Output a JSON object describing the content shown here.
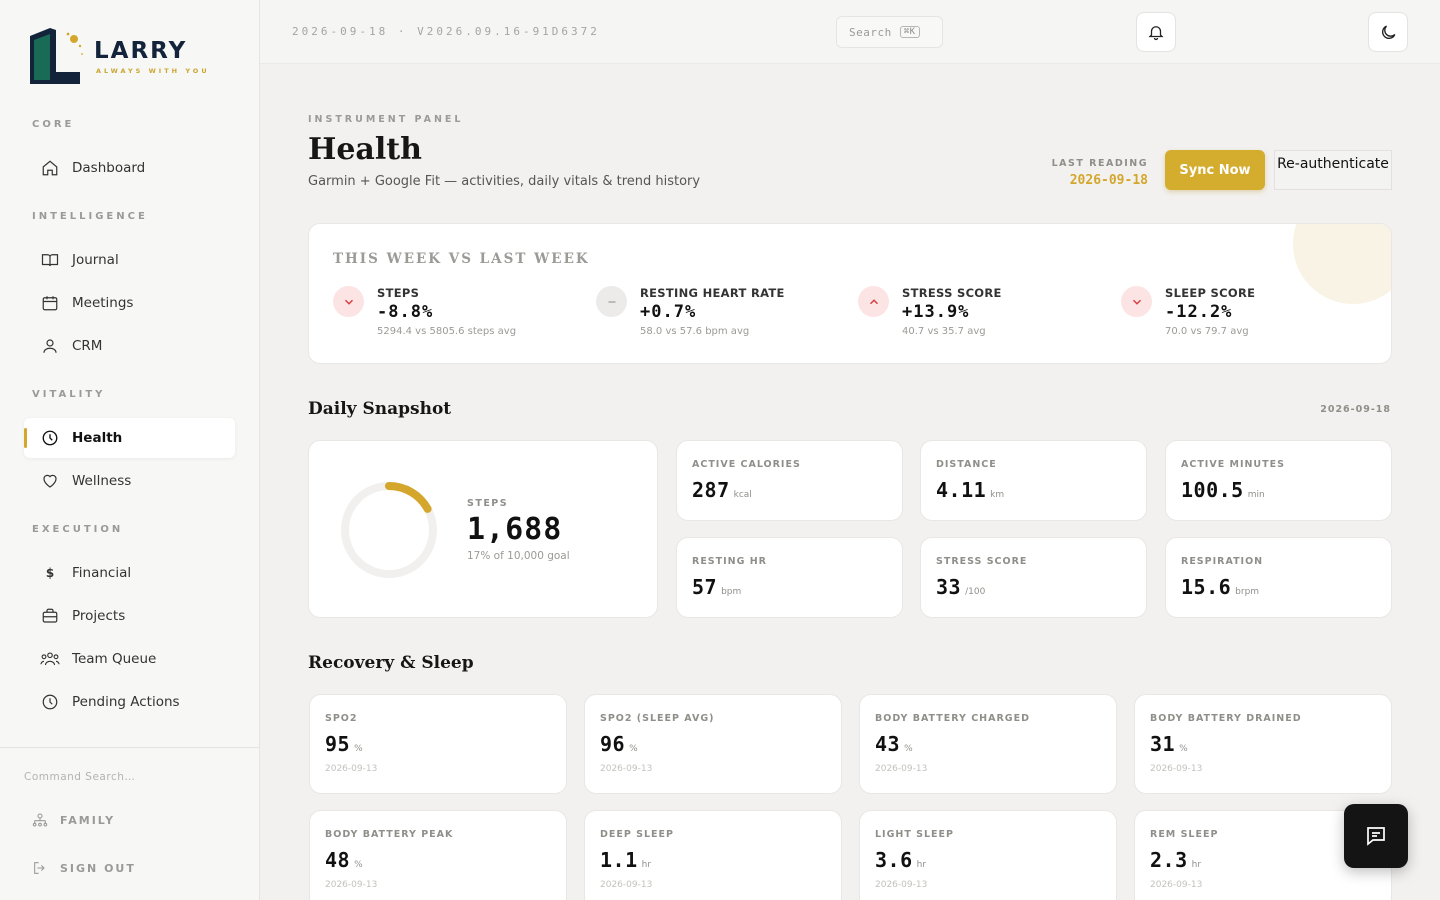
{
  "brand": {
    "name": "LARRY",
    "tagline": "ALWAYS WITH YOU",
    "accent": "#d4a72c",
    "navy": "#12233a",
    "green": "#1a6b55"
  },
  "topbar": {
    "meta": "2026-09-18 · V2026.09.16-91D6372",
    "search_label": "Search",
    "search_kbd": "⌘K",
    "bell_icon": "bell-icon",
    "theme_icon": "moon-icon"
  },
  "sidebar": {
    "sections": {
      "core": "CORE",
      "intelligence": "INTELLIGENCE",
      "vitality": "VITALITY",
      "execution": "EXECUTION"
    },
    "items": {
      "dashboard": {
        "label": "Dashboard",
        "icon": "home-icon"
      },
      "journal": {
        "label": "Journal",
        "icon": "book-icon"
      },
      "meetings": {
        "label": "Meetings",
        "icon": "calendar-icon"
      },
      "crm": {
        "label": "CRM",
        "icon": "user-icon"
      },
      "health": {
        "label": "Health",
        "icon": "clock-icon",
        "active": true
      },
      "wellness": {
        "label": "Wellness",
        "icon": "heart-icon"
      },
      "financial": {
        "label": "Financial",
        "icon": "dollar-icon"
      },
      "projects": {
        "label": "Projects",
        "icon": "briefcase-icon"
      },
      "team_queue": {
        "label": "Team Queue",
        "icon": "team-icon"
      },
      "pending_actions": {
        "label": "Pending Actions",
        "icon": "clock-icon"
      }
    },
    "command_search": "Command Search…",
    "family": "FAMILY",
    "sign_out": "SIGN OUT"
  },
  "header": {
    "eyebrow": "INSTRUMENT PANEL",
    "title": "Health",
    "subtitle": "Garmin + Google Fit — activities, daily vitals & trend history",
    "last_reading_label": "LAST READING",
    "last_reading_value": "2026-09-18",
    "sync_label": "Sync Now",
    "reauth_label": "Re-authenticate"
  },
  "week": {
    "title": "THIS WEEK VS LAST WEEK",
    "items": [
      {
        "label": "STEPS",
        "value": "-8.8%",
        "detail": "5294.4 vs 5805.6 steps avg",
        "trend": "down"
      },
      {
        "label": "RESTING HEART RATE",
        "value": "+0.7%",
        "detail": "58.0 vs 57.6 bpm avg",
        "trend": "flat"
      },
      {
        "label": "STRESS SCORE",
        "value": "+13.9%",
        "detail": "40.7 vs 35.7 avg",
        "trend": "up"
      },
      {
        "label": "SLEEP SCORE",
        "value": "-12.2%",
        "detail": "70.0 vs 79.7 avg",
        "trend": "down"
      }
    ]
  },
  "snapshot": {
    "title": "Daily Snapshot",
    "date": "2026-09-18",
    "steps": {
      "label": "STEPS",
      "value": "1,688",
      "goal": "17% of 10,000 goal",
      "progress": 0.17
    },
    "metrics": [
      {
        "label": "ACTIVE CALORIES",
        "value": "287",
        "unit": "kcal"
      },
      {
        "label": "DISTANCE",
        "value": "4.11",
        "unit": "km"
      },
      {
        "label": "ACTIVE MINUTES",
        "value": "100.5",
        "unit": "min"
      },
      {
        "label": "RESTING HR",
        "value": "57",
        "unit": "bpm"
      },
      {
        "label": "STRESS SCORE",
        "value": "33",
        "unit": "/100"
      },
      {
        "label": "RESPIRATION",
        "value": "15.6",
        "unit": "brpm"
      }
    ]
  },
  "recovery": {
    "title": "Recovery & Sleep",
    "metrics": [
      {
        "label": "SPO2",
        "value": "95",
        "unit": "%",
        "date": "2026-09-13"
      },
      {
        "label": "SPO2 (SLEEP AVG)",
        "value": "96",
        "unit": "%",
        "date": "2026-09-13"
      },
      {
        "label": "BODY BATTERY CHARGED",
        "value": "43",
        "unit": "%",
        "date": "2026-09-13"
      },
      {
        "label": "BODY BATTERY DRAINED",
        "value": "31",
        "unit": "%",
        "date": "2026-09-13"
      },
      {
        "label": "BODY BATTERY PEAK",
        "value": "48",
        "unit": "%",
        "date": "2026-09-13"
      },
      {
        "label": "DEEP SLEEP",
        "value": "1.1",
        "unit": "hr",
        "date": "2026-09-13"
      },
      {
        "label": "LIGHT SLEEP",
        "value": "3.6",
        "unit": "hr",
        "date": "2026-09-13"
      },
      {
        "label": "REM SLEEP",
        "value": "2.3",
        "unit": "hr",
        "date": "2026-09-13"
      }
    ]
  }
}
